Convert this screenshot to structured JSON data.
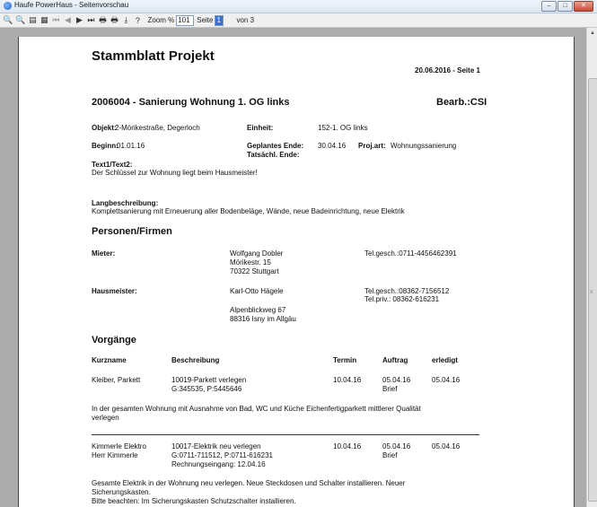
{
  "window": {
    "title": "Haufe PowerHaus - Seitenvorschau",
    "buttons": {
      "minimize": "–",
      "maximize": "□",
      "close": "✕"
    }
  },
  "toolbar": {
    "zoom_in": "🔍",
    "zoom_out": "🔍",
    "fit": "▤",
    "page_view": "▦",
    "first": "⏮",
    "prev": "◀",
    "next": "▶",
    "last": "⏭",
    "print": "🖶",
    "print_setup": "🖶",
    "export": "⤓",
    "help": "?",
    "zoom_label": "Zoom %",
    "zoom_value": "101",
    "page_label": "Seite",
    "page_value": "1",
    "of_label": "von 3"
  },
  "report": {
    "title": "Stammblatt Projekt",
    "date_page": "20.06.2016 - Seite 1",
    "project": "2006004 - Sanierung Wohnung 1. OG links",
    "bearb": "Bearb.:CSI",
    "objekt_label": "Objekt:",
    "objekt_value": "2-Mörikestraße,  Degerloch",
    "einheit_label": "Einheit:",
    "einheit_value": "152-1. OG links",
    "beginn_label": "Beginn:",
    "beginn_value": "01.01.16",
    "geplantes_ende_label": "Geplantes Ende:",
    "geplantes_ende_value": "30.04.16",
    "tatsaechl_ende_label": "Tatsächl. Ende:",
    "projart_label": "Proj.art:",
    "projart_value": "Wohnungssanierung",
    "text_label": "Text1/Text2:",
    "text_value": "Der Schlüssel zur Wohnung liegt beim Hausmeister!",
    "lang_label": "Langbeschreibung:",
    "lang_value": "Komplettsanierung mit Erneuerung aller Bodenbeläge, Wände, neue Badeinrichtung, neue Elektrik",
    "personen_heading": "Personen/Firmen",
    "mieter_label": "Mieter:",
    "mieter_name": "Wolfgang  Dobler",
    "mieter_street": "Mörikestr. 15",
    "mieter_city": "70322  Stuttgart",
    "mieter_tel": "Tel.gesch.:0711-4456462391",
    "hausmeister_label": "Hausmeister:",
    "hausmeister_name": "Karl-Otto  Hägele",
    "hausmeister_street": "Alpenblickweg  67",
    "hausmeister_city": "88316 Isny im Allgäu",
    "hausmeister_tel1": "Tel.gesch.:08362-7156512",
    "hausmeister_tel2": "Tel.priv.:   08362-616231",
    "vorgaenge_heading": "Vorgänge",
    "col_kurzname": "Kurzname",
    "col_beschreibung": "Beschreibung",
    "col_termin": "Termin",
    "col_auftrag": "Auftrag",
    "col_erledigt": "erledigt",
    "v1_kurzname": "Kleiber, Parkett",
    "v1_desc1": "10019-Parkett  verlegen",
    "v1_desc2": "G:345535,  P:5445646",
    "v1_termin": "10.04.16",
    "v1_auftrag": "05.04.16",
    "v1_auftrag2": "Brief",
    "v1_erledigt": "05.04.16",
    "v1_note1": "In der gesamten Wohnung mit Ausnahme von Bad, WC und Küche Eichenfertigparkett mittlerer Qualität",
    "v1_note2": "verlegen",
    "v2_kurzname1": "Kimmerle Elektro",
    "v2_kurzname2": "Herr Kimmerle",
    "v2_desc1": "10017-Elektrik  neu  verlegen",
    "v2_desc2": "G:0711-711512,   P:0711-616231",
    "v2_desc3": "Rechnungseingang:   12.04.16",
    "v2_termin": "10.04.16",
    "v2_auftrag": "05.04.16",
    "v2_auftrag2": "Brief",
    "v2_erledigt": "05.04.16",
    "v2_note1": "Gesamte Elektrik in der Wohnung neu verlegen. Neue Steckdosen und Schalter installieren. Neuer",
    "v2_note2": "Sicherungskasten.",
    "v2_note3": "Bitte beachten: Im Sicherungskasten Schutzschalter installieren."
  }
}
